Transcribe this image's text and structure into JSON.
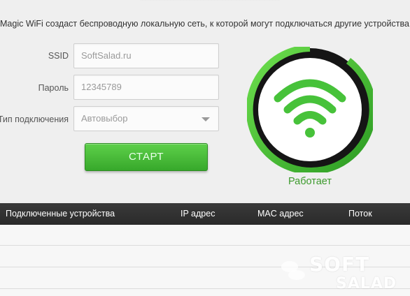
{
  "description": "Magic WiFi создаст беспроводную локальную сеть, к которой могут подключаться другие устройства.",
  "form": {
    "ssid_label": "SSID",
    "ssid_value": "SoftSalad.ru",
    "password_label": "Пароль",
    "password_value": "12345789",
    "conn_type_label": "Тип подключения",
    "conn_type_value": "Автовыбор"
  },
  "start_button": "СТАРТ",
  "status": {
    "text": "Работает",
    "color": "#3c9a2c",
    "icon": "wifi-icon"
  },
  "table": {
    "headers": [
      "Подключенные устройства",
      "IP адрес",
      "MAC адрес",
      "Поток"
    ]
  },
  "watermark": {
    "line1": "SOFT",
    "line2": "SALAD"
  },
  "colors": {
    "accent_green": "#3fb52f",
    "header_bg": "#2f2f2f"
  }
}
